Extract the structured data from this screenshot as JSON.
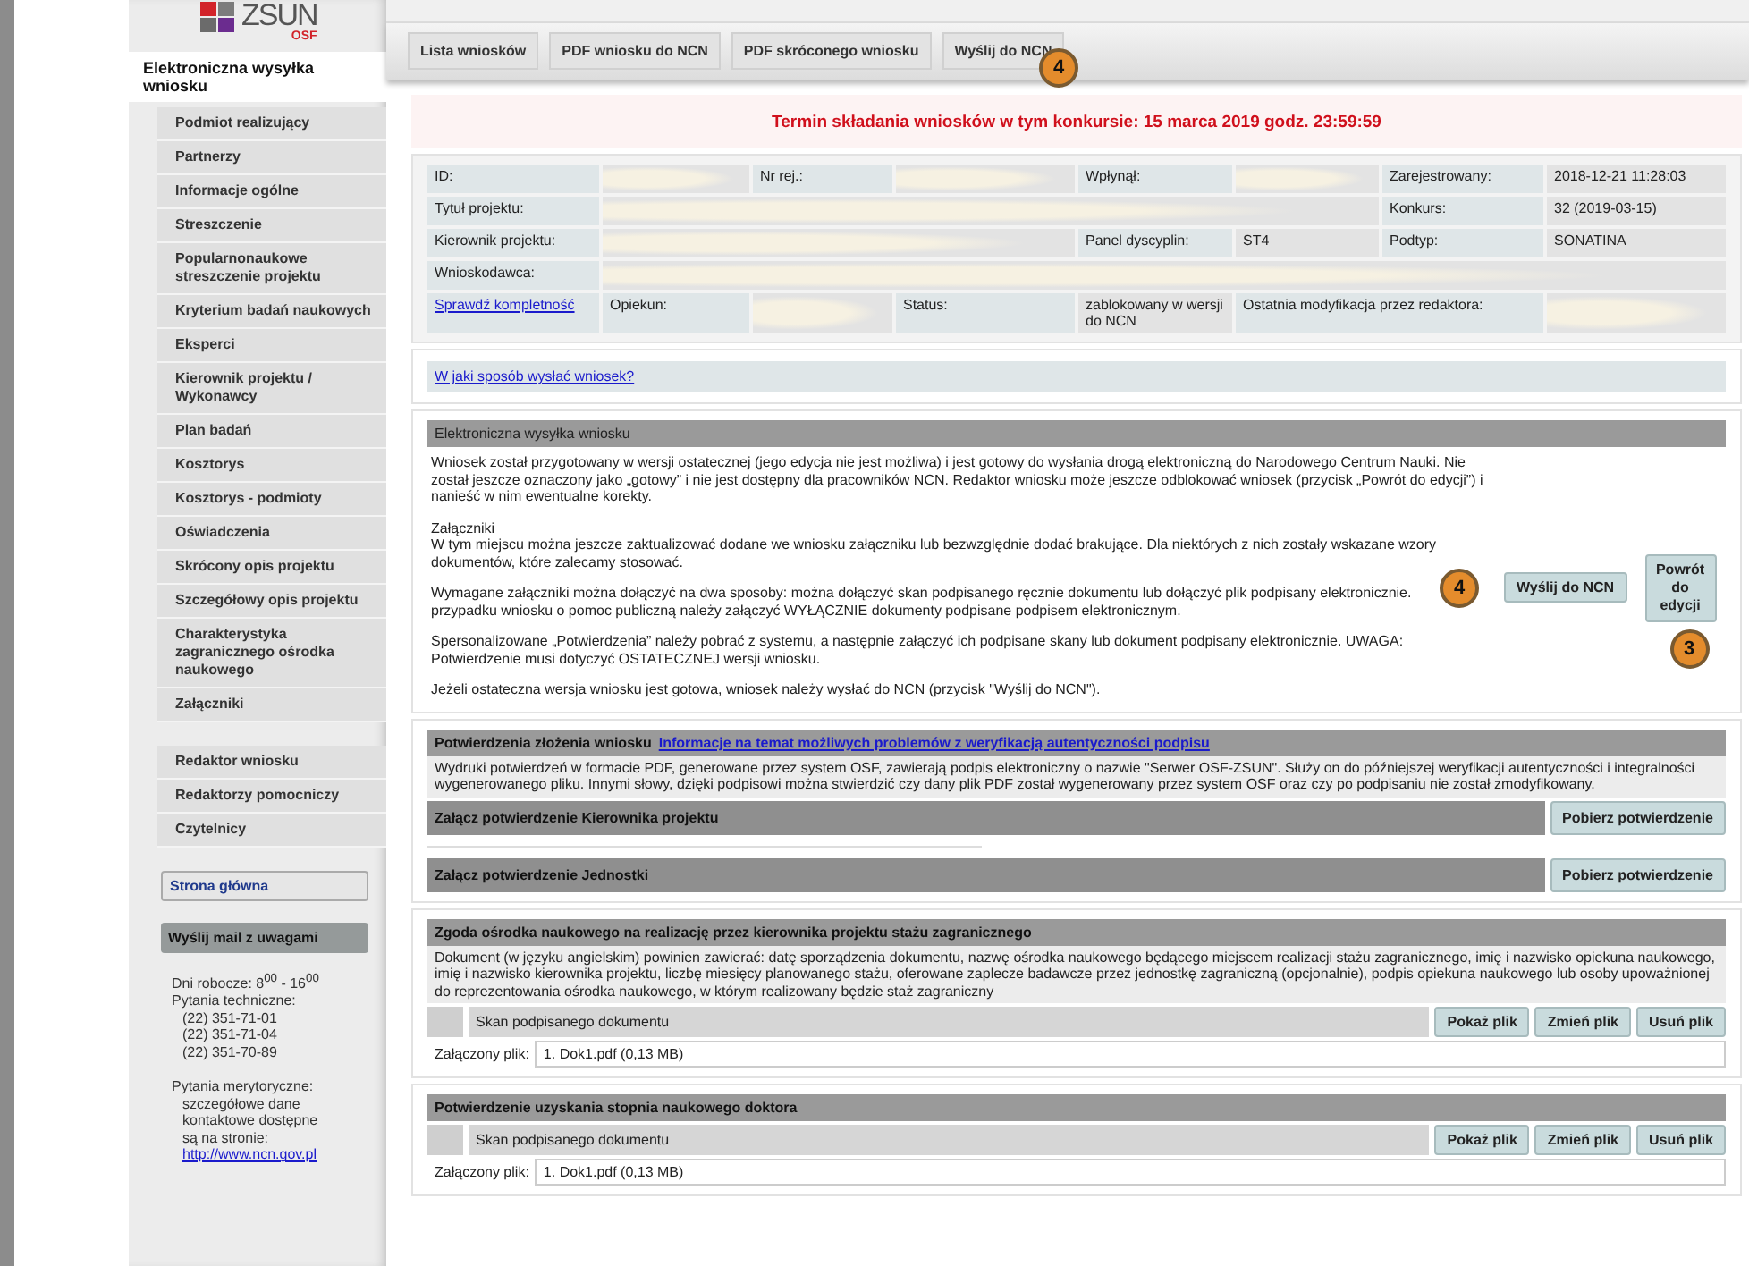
{
  "logo": {
    "text": "ZSUN",
    "subtext": "OSF"
  },
  "tabs": [
    {
      "label": "Lista wniosków",
      "selected": false
    },
    {
      "label": "PDF wniosku do NCN",
      "selected": false
    },
    {
      "label": "PDF skróconego wniosku",
      "selected": false
    },
    {
      "label": "Wyślij do NCN",
      "selected": false
    }
  ],
  "tabs_callout": "4",
  "sidebar": {
    "groups": [
      [
        {
          "label": "Elektroniczna wysyłka wniosku",
          "selected": true
        },
        {
          "label": "Podmiot realizujący",
          "selected": false
        },
        {
          "label": "Partnerzy",
          "selected": false
        },
        {
          "label": "Informacje ogólne",
          "selected": false
        },
        {
          "label": "Streszczenie",
          "selected": false
        },
        {
          "label": "Popularnonaukowe streszczenie projektu",
          "selected": false
        },
        {
          "label": "Kryterium badań naukowych",
          "selected": false
        },
        {
          "label": "Eksperci",
          "selected": false
        },
        {
          "label": "Kierownik projektu / Wykonawcy",
          "selected": false
        },
        {
          "label": "Plan badań",
          "selected": false
        },
        {
          "label": "Kosztorys",
          "selected": false
        },
        {
          "label": "Kosztorys - podmioty",
          "selected": false
        },
        {
          "label": "Oświadczenia",
          "selected": false
        },
        {
          "label": "Skrócony opis projektu",
          "selected": false
        },
        {
          "label": "Szczegółowy opis projektu",
          "selected": false
        },
        {
          "label": "Charakterystyka zagranicznego ośrodka naukowego",
          "selected": false
        },
        {
          "label": "Załączniki",
          "selected": false
        }
      ],
      [
        {
          "label": "Redaktor wniosku",
          "selected": false
        },
        {
          "label": "Redaktorzy pomocniczy",
          "selected": false
        },
        {
          "label": "Czytelnicy",
          "selected": false
        }
      ]
    ],
    "home_link": "Strona główna",
    "mail_button": "Wyślij mail z uwagami",
    "contact": [
      [
        {
          "kind": "text",
          "text": "Dni robocze: 8$^{00}$ - 16$^{00}$"
        },
        {
          "kind": "text",
          "text": "Pytania techniczne:"
        },
        {
          "kind": "indented",
          "text": "(22) 351-71-01"
        },
        {
          "kind": "indented",
          "text": "(22) 351-71-04"
        },
        {
          "kind": "indented",
          "text": "(22) 351-70-89"
        }
      ],
      [
        {
          "kind": "text",
          "text": "Pytania merytoryczne:"
        },
        {
          "kind": "indented",
          "text": "szczegółowe dane"
        },
        {
          "kind": "indented",
          "text": "kontaktowe dostępne"
        },
        {
          "kind": "indented",
          "text": "są na stronie:"
        },
        {
          "kind": "link",
          "text": "http://www.ncn.gov.pl"
        }
      ]
    ]
  },
  "deadline": "Termin składania wniosków w tym konkursie: 15 marca 2019 godz. 23:59:59",
  "info_table": {
    "rows": [
      [
        {
          "kind": "label",
          "text": "ID:"
        },
        {
          "kind": "redacted"
        },
        {
          "kind": "label",
          "text": "Nr rej.:"
        },
        {
          "kind": "redacted"
        },
        {
          "kind": "label",
          "text": "Wpłynął:"
        },
        {
          "kind": "redacted"
        },
        {
          "kind": "label",
          "text": "Zarejestrowany:"
        },
        {
          "kind": "value",
          "text": "2018-12-21 11:28:03"
        }
      ],
      [
        {
          "kind": "label",
          "text": "Tytuł projektu:"
        },
        {
          "kind": "redacted"
        },
        {
          "kind": "continued"
        },
        {
          "kind": "continued"
        },
        {
          "kind": "continued"
        },
        {
          "kind": "continued"
        },
        {
          "kind": "label",
          "text": "Konkurs:"
        },
        {
          "kind": "value",
          "text": "32 (2019-03-15)"
        }
      ],
      [
        {
          "kind": "label",
          "text": "Kierownik projektu:"
        },
        {
          "kind": "redacted"
        },
        {
          "kind": "continued"
        },
        {
          "kind": "continued"
        },
        {
          "kind": "label",
          "text": "Panel dyscyplin:"
        },
        {
          "kind": "value",
          "text": "ST4"
        },
        {
          "kind": "label",
          "text": "Podtyp:"
        },
        {
          "kind": "value",
          "text": "SONATINA"
        }
      ],
      [
        {
          "kind": "label",
          "text": "Wnioskodawca:"
        },
        {
          "kind": "redacted"
        },
        {
          "kind": "continued"
        },
        {
          "kind": "continued"
        },
        {
          "kind": "continued"
        },
        {
          "kind": "continued"
        },
        {
          "kind": "continued"
        },
        {
          "kind": "continued"
        }
      ],
      [
        {
          "kind": "link",
          "text": "Sprawdź kompletność"
        },
        {
          "kind": "label",
          "text": "Opiekun:"
        },
        {
          "kind": "redacted"
        },
        {
          "kind": "label",
          "text": "Status:"
        },
        {
          "kind": "value",
          "text": "zablokowany w wersji do NCN"
        },
        {
          "kind": "label",
          "text": "Ostatnia modyfikacja przez redaktora:"
        },
        {
          "kind": "continued"
        },
        {
          "kind": "redacted"
        }
      ]
    ]
  },
  "help_link": "W jaki sposób wysłać wniosek?",
  "send_section": {
    "title": "Elektroniczna wysyłka wniosku",
    "paragraphs": [
      [
        "Wniosek został przygotowany w wersji ostatecznej (jego edycja nie jest możliwa) i jest gotowy do wysłania drogą elektroniczną do Narodowego Centrum Nauki. Nie został jeszcze oznaczony jako „gotowy” i nie jest dostępny dla pracowników NCN. Redaktor wniosku może jeszcze odblokować wniosek (przycisk „Powrót do edycji”) i nanieść w nim ewentualne korekty."
      ],
      [
        "Załączniki",
        "W tym miejscu można jeszcze zaktualizować dodane we wniosku załączniku lub bezwzględnie dodać brakujące. Dla niektórych z nich zostały wskazane wzory dokumentów, które zalecamy stosować."
      ],
      [
        "Wymagane załączniki można dołączyć na dwa sposoby: można dołączyć skan podpisanego ręcznie dokumentu lub dołączyć plik podpisany elektronicznie.",
        "przypadku wniosku o pomoc publiczną należy załączyć WYŁĄCZNIE dokumenty podpisane podpisem elektronicznym."
      ],
      [
        "Spersonalizowane „Potwierdzenia” należy pobrać z systemu, a następnie załączyć ich podpisane skany lub dokument podpisany elektronicznie. UWAGA: Potwierdzenie musi dotyczyć OSTATECZNEJ wersji wniosku."
      ],
      [
        "Jeżeli ostateczna wersja wniosku jest gotowa, wniosek należy wysłać do NCN (przycisk \"Wyślij do NCN\")."
      ]
    ],
    "buttons": [
      {
        "label": "Wyślij do NCN",
        "callout": "4"
      },
      {
        "label": "Powrót do edycji",
        "callout": "3"
      }
    ]
  },
  "confirmation_section": {
    "title": "Potwierdzenia złożenia wniosku",
    "link": "Informacje na temat możliwych problemów z weryfikacją autentyczności podpisu",
    "description": "Wydruki potwierdzeń w formacie PDF, generowane przez system OSF, zawierają podpis elektroniczny o nazwie \"Serwer OSF-ZSUN\". Służy on do późniejszej weryfikacji autentyczności i integralności wygenerowanego pliku. Innymi słowy, dzięki podpisowi można stwierdzić czy dany plik PDF został wygenerowany przez system OSF oraz czy po podpisaniu nie został zmodyfikowany.",
    "rows": [
      {
        "label": "Załącz potwierdzenie Kierownika projektu",
        "button": "Pobierz potwierdzenie"
      },
      {
        "label": "Załącz potwierdzenie Jednostki",
        "button": "Pobierz potwierdzenie"
      }
    ]
  },
  "attachments": [
    {
      "title": "Zgoda ośrodka naukowego na realizację przez kierownika projektu stażu zagranicznego",
      "description": "Dokument (w języku angielskim) powinien zawierać: datę sporządzenia dokumentu, nazwę ośrodka naukowego będącego miejscem realizacji stażu zagranicznego, imię i nazwisko opiekuna naukowego, imię i nazwisko kierownika projektu, liczbę miesięcy planowanego stażu, oferowane zaplecze badawcze przez jednostkę zagraniczną (opcjonalnie), podpis opiekuna naukowego lub osoby upoważnionej do reprezentowania ośrodka naukowego, w którym realizowany będzie staż zagraniczny",
      "file_label": "Skan podpisanego dokumentu",
      "buttons": [
        "Pokaż plik",
        "Zmień plik",
        "Usuń plik"
      ],
      "attached_label": "Załączony plik:",
      "attached_value": "1. Dok1.pdf (0,13 MB)"
    },
    {
      "title": "Potwierdzenie uzyskania stopnia naukowego doktora",
      "file_label": "Skan podpisanego dokumentu",
      "buttons": [
        "Pokaż plik",
        "Zmień plik",
        "Usuń plik"
      ],
      "attached_label": "Załączony plik:",
      "attached_value": "1. Dok1.pdf (0,13 MB)"
    }
  ]
}
